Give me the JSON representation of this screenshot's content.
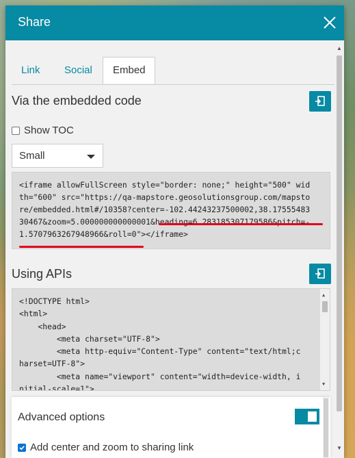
{
  "dialog": {
    "title": "Share",
    "close_icon": "close-icon"
  },
  "tabs": [
    {
      "label": "Link",
      "active": false
    },
    {
      "label": "Social",
      "active": false
    },
    {
      "label": "Embed",
      "active": true
    }
  ],
  "embed_section": {
    "title": "Via the embedded code",
    "copy_icon": "copy-to-clipboard-icon",
    "show_toc_label": "Show TOC",
    "show_toc_checked": false,
    "size_select_value": "Small",
    "code_lines": [
      "<iframe allowFullScreen style=\"border: none;\" height=\"500\" wid",
      "th=\"600\" src=\"https://qa-mapstore.geosolutionsgroup.com/mapsto",
      "re/embedded.html#/10358?center=-102.44243237500002,38.17555483",
      "30467&zoom=5.000000000000001&heading=6.283185307179586&pitch=-",
      "1.5707963267948966&roll=0\"></iframe>"
    ]
  },
  "api_section": {
    "title": "Using APIs",
    "copy_icon": "copy-to-clipboard-icon",
    "code": "<!DOCTYPE html>\n<html>\n    <head>\n        <meta charset=\"UTF-8\">\n        <meta http-equiv=\"Content-Type\" content=\"text/html;c\nharset=UTF-8\">\n        <meta name=\"viewport\" content=\"width=device-width, i\nnitial-scale=1\">"
  },
  "advanced": {
    "title": "Advanced options",
    "toggle_on": true,
    "add_center_label": "Add center and zoom to sharing link",
    "add_center_checked": true
  },
  "colors": {
    "header": "#078aa3",
    "accent": "#078aa3",
    "highlight_underline": "#e0001b"
  }
}
